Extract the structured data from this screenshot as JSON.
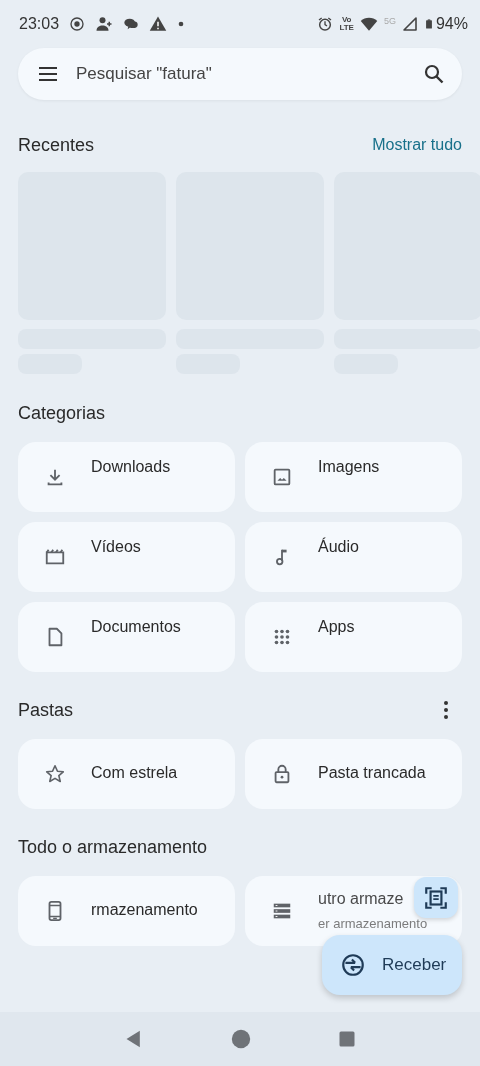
{
  "status_bar": {
    "time": "23:03",
    "volte_top": "Vo",
    "volte_bottom": "LTE",
    "network": "5G",
    "battery": "94%"
  },
  "search": {
    "placeholder": "Pesquisar \"fatura\""
  },
  "recents": {
    "title": "Recentes",
    "action": "Mostrar tudo"
  },
  "categories": {
    "title": "Categorias",
    "items": [
      {
        "label": "Downloads",
        "kind": "download"
      },
      {
        "label": "Imagens",
        "kind": "image"
      },
      {
        "label": "Vídeos",
        "kind": "video"
      },
      {
        "label": "Áudio",
        "kind": "audio"
      },
      {
        "label": "Documentos",
        "kind": "document"
      },
      {
        "label": "Apps",
        "kind": "apps"
      }
    ]
  },
  "folders": {
    "title": "Pastas",
    "items": [
      {
        "label": "Com estrela",
        "kind": "star"
      },
      {
        "label": "Pasta trancada",
        "kind": "lock"
      }
    ]
  },
  "storage": {
    "title": "Todo o armazenamento",
    "items": [
      {
        "label": "rmazenamento",
        "kind": "phone"
      },
      {
        "label": "utro armaze",
        "sublabel": "er armazenamento",
        "kind": "storage"
      }
    ]
  },
  "fab": {
    "label": "Receber"
  }
}
